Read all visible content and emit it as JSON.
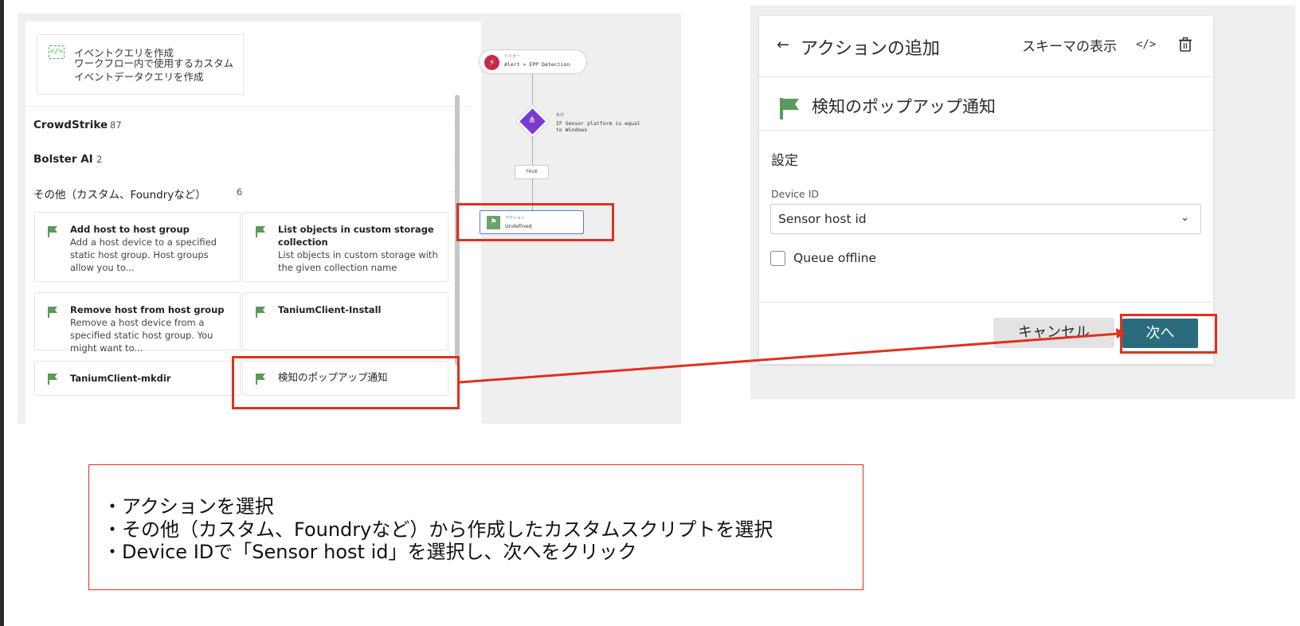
{
  "left_panel": {
    "query_card": {
      "title": "イベントクエリを作成",
      "description": "ワークフロー内で使用するカスタムイベントデータクエリを作成",
      "icon": "code-icon"
    },
    "categories": [
      {
        "name": "CrowdStrike",
        "count": "87",
        "expanded": false
      },
      {
        "name": "Bolster AI",
        "count": "2",
        "expanded": false
      },
      {
        "name": "その他（カスタム、Foundryなど）",
        "count": "6",
        "expanded": true
      }
    ],
    "actions": [
      {
        "title": "Add host to host group",
        "description": "Add a host device to a specified static host group. Host groups allow you to..."
      },
      {
        "title": "List objects in custom storage collection",
        "description": "List objects in custom storage with the given collection name"
      },
      {
        "title": "Remove host from host group",
        "description": "Remove a host device from a specified static host group. You might want to..."
      },
      {
        "title": "TaniumClient-Install",
        "description": ""
      },
      {
        "title": "TaniumClient-mkdir",
        "description": ""
      },
      {
        "title": "検知のポップアップ通知",
        "description": ""
      }
    ]
  },
  "workflow": {
    "trigger_label": "トリガー",
    "trigger_text": "Alert > EPP Detection",
    "condition_label": "条件",
    "condition_text": "IF Sensor platform is equal to Windows",
    "branch_label": "TRUE",
    "action_label": "アクション",
    "action_text": "Undefined"
  },
  "dialog": {
    "back_icon": "arrow-left-icon",
    "title": "アクションの追加",
    "schema_label": "スキーマの表示",
    "code_icon_text": "</>",
    "action_name": "検知のポップアップ通知",
    "section_title": "設定",
    "device_id_label": "Device ID",
    "device_id_value": "Sensor host id",
    "queue_offline_label": "Queue offline",
    "queue_offline_checked": false,
    "cancel_label": "キャンセル",
    "next_label": "次へ"
  },
  "note": {
    "lines": [
      "・アクションを選択",
      "・その他（カスタム、Foundryなど）から作成したカスタムスクリプトを選択",
      "・Device IDで「Sensor host id」を選択し、次へをクリック"
    ]
  },
  "colors": {
    "highlight": "#e0301e",
    "flag_green": "#5a9a5c",
    "next_button": "#2a6c7d",
    "trigger_red": "#c62848",
    "condition_purple": "#7a3bd1"
  }
}
